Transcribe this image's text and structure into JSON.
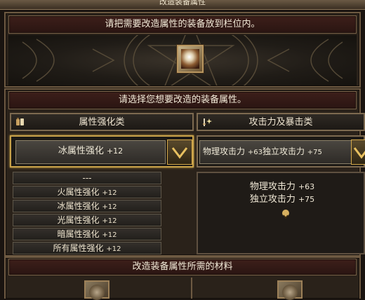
{
  "window": {
    "title": "改造装备属性"
  },
  "upload_section": {
    "instruction": "请把需要改造属性的装备放到栏位内。",
    "slot_item_icon": "equipment-item-icon"
  },
  "attribute_section": {
    "instruction": "请选择您想要改造的装备属性。",
    "left_column": {
      "header": "属性强化类",
      "header_icon": "potion-bottles-icon",
      "selected": {
        "label": "冰属性强化",
        "bonus": "+12"
      },
      "options": [
        {
          "label": "---",
          "bonus": ""
        },
        {
          "label": "火属性强化",
          "bonus": "+12"
        },
        {
          "label": "冰属性强化",
          "bonus": "+12"
        },
        {
          "label": "光属性强化",
          "bonus": "+12"
        },
        {
          "label": "暗属性强化",
          "bonus": "+12"
        },
        {
          "label": "所有属性强化",
          "bonus": "+12"
        }
      ]
    },
    "right_column": {
      "header": "攻击力及暴击类",
      "header_icon": "sword-sparkle-icon",
      "selected": {
        "label1": "物理攻击力",
        "bonus1": "+63",
        "label2": "独立攻击力",
        "bonus2": "+75"
      },
      "detail": [
        {
          "label": "物理攻击力",
          "bonus": "+63"
        },
        {
          "label": "独立攻击力",
          "bonus": "+75"
        }
      ]
    }
  },
  "materials_section": {
    "title": "改造装备属性所需的材料"
  },
  "colors": {
    "gold_border": "#c9a24a",
    "header_red": "#3d1f1a",
    "panel_bg": "#2a221a"
  }
}
